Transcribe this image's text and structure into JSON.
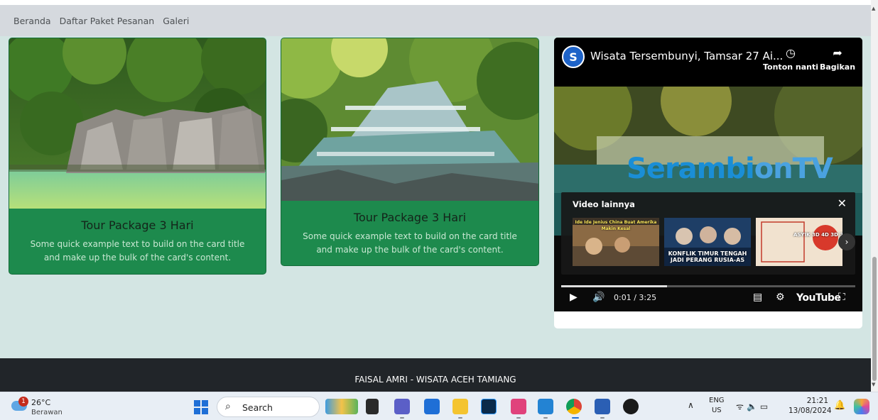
{
  "nav": {
    "items": [
      "Beranda",
      "Daftar Paket Pesanan",
      "Galeri"
    ]
  },
  "cards": [
    {
      "title": "Tour Package 3 Hari",
      "text": "Some quick example text to build on the card title and make up the bulk of the card's content."
    },
    {
      "title": "Tour Package 3 Hari",
      "text": "Some quick example text to build on the card title and make up the bulk of the card's content."
    }
  ],
  "video": {
    "title": "Wisata Tersembunyi, Tamsar 27 Ai...",
    "channel_logo": "S",
    "watch_later": "Tonton nanti",
    "share": "Bagikan",
    "brand_a": "Serambi",
    "brand_b": "onTV",
    "more_videos_title": "Video lainnya",
    "thumbs": [
      {
        "text": "Ide Ide Jenius China Buat Amerika Makin Kesal"
      },
      {
        "text": "KONFLIK TIMUR TENGAH JADI PERANG RUSIA-AS"
      },
      {
        "text": "ASYIK 3D 4D 3D 2D"
      }
    ],
    "progress": 0.005,
    "time": "0:01 / 3:25",
    "yt_label": "YouTube"
  },
  "footer": {
    "text": "FAISAL AMRI - WISATA ACEH TAMIANG"
  },
  "taskbar": {
    "weather_temp": "26°C",
    "weather_desc": "Berawan",
    "weather_badge": "1",
    "search_label": "Search",
    "lang_line1": "ENG",
    "lang_line2": "US",
    "time": "21:21",
    "date": "13/08/2024"
  },
  "colors": {
    "card_bg": "#1d8a4d",
    "footer_bg": "#212529",
    "page_bg": "#d3e5e3",
    "navbar_bg": "#d5d9de"
  }
}
